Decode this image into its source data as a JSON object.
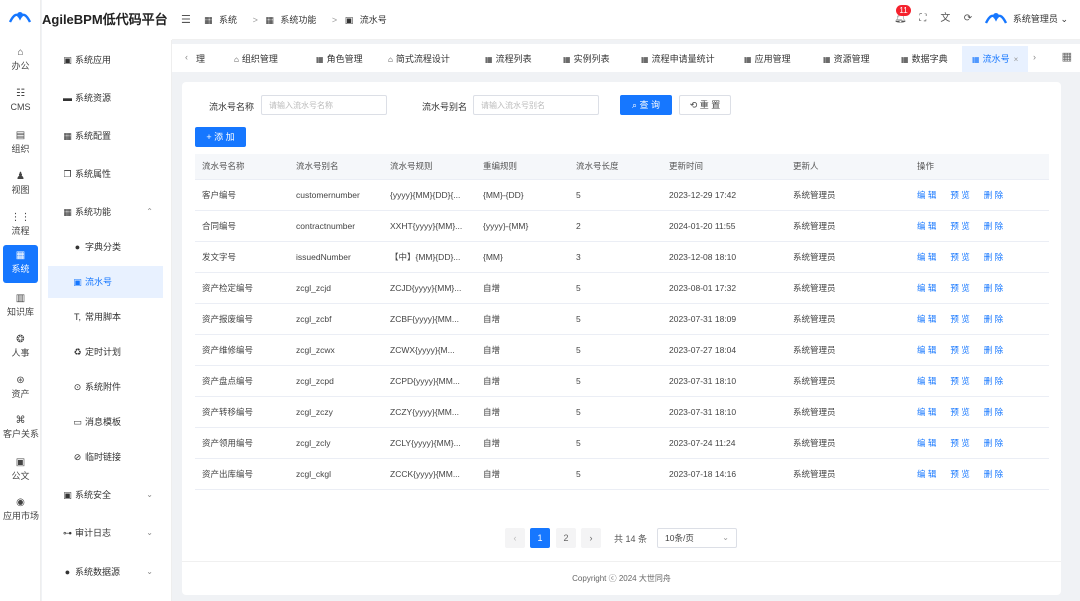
{
  "app": {
    "title": "AgileBPM低代码平台"
  },
  "rail": [
    {
      "label": "办公",
      "icon": "⌂",
      "name": "home-icon"
    },
    {
      "label": "CMS",
      "icon": "☷",
      "name": "cms-icon"
    },
    {
      "label": "组织",
      "icon": "▤",
      "name": "org-icon"
    },
    {
      "label": "视图",
      "icon": "♟",
      "name": "view-icon"
    },
    {
      "label": "流程",
      "icon": "⋮⋮",
      "name": "flow-icon"
    },
    {
      "label": "系统",
      "icon": "▦",
      "name": "system-icon"
    },
    {
      "label": "知识库",
      "icon": "▥",
      "name": "knowledge-icon"
    },
    {
      "label": "人事",
      "icon": "❂",
      "name": "hr-icon"
    },
    {
      "label": "资产",
      "icon": "⊛",
      "name": "asset-icon"
    },
    {
      "label": "客户关系",
      "icon": "⌘",
      "name": "crm-icon"
    },
    {
      "label": "公文",
      "icon": "▣",
      "name": "doc-icon"
    },
    {
      "label": "应用市场",
      "icon": "◉",
      "name": "market-icon"
    }
  ],
  "sidebar": {
    "items": [
      {
        "label": "系统应用",
        "icon": "▣"
      },
      {
        "label": "系统资源",
        "icon": "▬"
      },
      {
        "label": "系统配置",
        "icon": "▦"
      },
      {
        "label": "系统属性",
        "icon": "❐"
      },
      {
        "label": "系统功能",
        "icon": "▦",
        "chevron": "⌃"
      },
      {
        "label": "字典分类",
        "icon": "●"
      },
      {
        "label": "流水号",
        "icon": "▣"
      },
      {
        "label": "常用脚本",
        "icon": "T,"
      },
      {
        "label": "定时计划",
        "icon": "♻"
      },
      {
        "label": "系统附件",
        "icon": "⊙"
      },
      {
        "label": "消息模板",
        "icon": "▭"
      },
      {
        "label": "临时链接",
        "icon": "⊘"
      },
      {
        "label": "系统安全",
        "icon": "▣",
        "chevron": "⌄"
      },
      {
        "label": "审计日志",
        "icon": "⊶",
        "chevron": "⌄"
      },
      {
        "label": "系统数据源",
        "icon": "●",
        "chevron": "⌄"
      }
    ]
  },
  "header": {
    "menu_icon": "☰",
    "breadcrumb": [
      {
        "label": "系统",
        "icon": "▦"
      },
      {
        "label": "系统功能",
        "icon": "▦"
      },
      {
        "label": "流水号",
        "icon": "▣"
      }
    ],
    "breadcrumb_sep": ">",
    "notification_count": "11",
    "user": {
      "name": "系统管理员",
      "caret": "⌄"
    }
  },
  "tabs": {
    "left_arrow": "‹",
    "right_arrow": "›",
    "items": [
      {
        "label": "理",
        "icon": ""
      },
      {
        "label": "组织管理",
        "icon": "⌂"
      },
      {
        "label": "角色管理",
        "icon": "▦"
      },
      {
        "label": "简式流程设计",
        "icon": "⌂"
      },
      {
        "label": "流程列表",
        "icon": "▦"
      },
      {
        "label": "实例列表",
        "icon": "▦"
      },
      {
        "label": "流程申请量统计",
        "icon": "▦"
      },
      {
        "label": "应用管理",
        "icon": "▦"
      },
      {
        "label": "资源管理",
        "icon": "▦"
      },
      {
        "label": "数据字典",
        "icon": "▦"
      },
      {
        "label": "流水号",
        "icon": "▦",
        "close": "×"
      }
    ]
  },
  "search": {
    "name_label": "流水号名称",
    "name_placeholder": "请输入流水号名称",
    "alias_label": "流水号别名",
    "alias_placeholder": "请输入流水号别名",
    "query_label": "查 询",
    "reset_label": "重 置",
    "add_label": "+ 添 加"
  },
  "table": {
    "headers": [
      "流水号名称",
      "流水号别名",
      "流水号规则",
      "重编规则",
      "流水号长度",
      "更新时间",
      "更新人",
      "操作"
    ],
    "actions": [
      "编 辑",
      "预 览",
      "删 除"
    ],
    "rows": [
      [
        "客户编号",
        "customernumber",
        "{yyyy}{MM}{DD}{...",
        "{MM}-{DD}",
        "5",
        "2023-12-29 17:42",
        "系统管理员"
      ],
      [
        "合同编号",
        "contractnumber",
        "XXHT{yyyy}{MM}...",
        "{yyyy}-{MM}",
        "2",
        "2024-01-20 11:55",
        "系统管理员"
      ],
      [
        "发文字号",
        "issuedNumber",
        "【中】{MM}{DD}...",
        "{MM}",
        "3",
        "2023-12-08 18:10",
        "系统管理员"
      ],
      [
        "资产检定编号",
        "zcgl_zcjd",
        "ZCJD{yyyy}{MM}...",
        "自增",
        "5",
        "2023-08-01 17:32",
        "系统管理员"
      ],
      [
        "资产报废编号",
        "zcgl_zcbf",
        "ZCBF{yyyy}{MM...",
        "自增",
        "5",
        "2023-07-31 18:09",
        "系统管理员"
      ],
      [
        "资产维修编号",
        "zcgl_zcwx",
        "ZCWX{yyyy}{M...",
        "自增",
        "5",
        "2023-07-27 18:04",
        "系统管理员"
      ],
      [
        "资产盘点编号",
        "zcgl_zcpd",
        "ZCPD{yyyy}{MM...",
        "自增",
        "5",
        "2023-07-31 18:10",
        "系统管理员"
      ],
      [
        "资产转移编号",
        "zcgl_zczy",
        "ZCZY{yyyy}{MM...",
        "自增",
        "5",
        "2023-07-31 18:10",
        "系统管理员"
      ],
      [
        "资产领用编号",
        "zcgl_zcly",
        "ZCLY{yyyy}{MM}...",
        "自增",
        "5",
        "2023-07-24 11:24",
        "系统管理员"
      ],
      [
        "资产出库编号",
        "zcgl_ckgl",
        "ZCCK{yyyy}{MM...",
        "自增",
        "5",
        "2023-07-18 14:16",
        "系统管理员"
      ]
    ]
  },
  "pagination": {
    "prev": "‹",
    "next": "›",
    "pages": [
      "1",
      "2"
    ],
    "current": "1",
    "total": "共 14 条",
    "page_size": "10条/页",
    "caret": "⌄"
  },
  "footer": {
    "text": "Copyright ⓒ 2024 大世同舟"
  },
  "colors": {
    "primary": "#1677ff",
    "badge": "#f5222d"
  }
}
